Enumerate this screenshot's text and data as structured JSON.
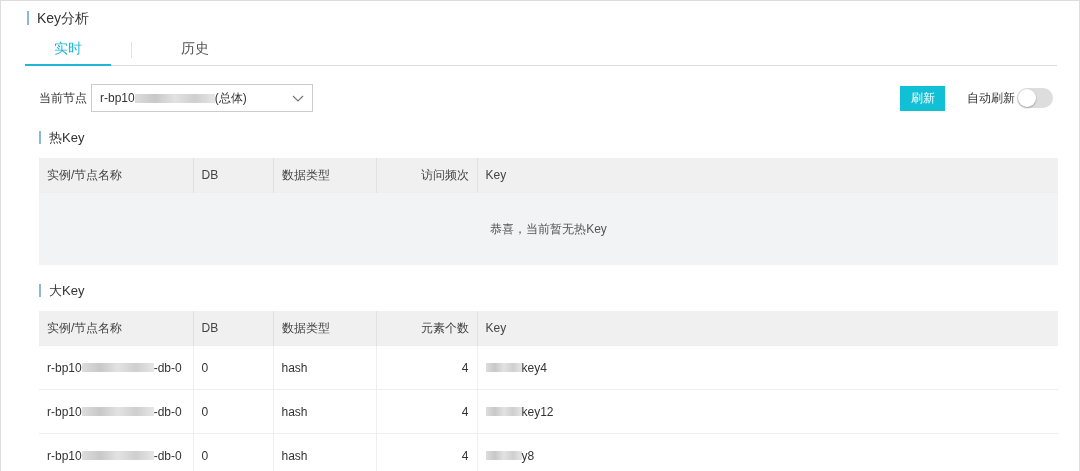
{
  "title": "Key分析",
  "tabs": [
    {
      "label": "实时",
      "selected": true
    },
    {
      "label": "历史",
      "selected": false
    }
  ],
  "node": {
    "label": "当前节点",
    "prefix": "r-bp10",
    "suffix": "(总体)"
  },
  "refresh_button": "刷新",
  "auto_refresh": {
    "label": "自动刷新",
    "on": false
  },
  "hot_key": {
    "title": "热Key",
    "columns": [
      "实例/节点名称",
      "DB",
      "数据类型",
      "访问频次",
      "Key"
    ],
    "empty": "恭喜，当前暂无热Key"
  },
  "big_key": {
    "title": "大Key",
    "columns": [
      "实例/节点名称",
      "DB",
      "数据类型",
      "元素个数",
      "Key"
    ],
    "rows": [
      {
        "name_prefix": "r-bp10",
        "name_suffix": "-db-0",
        "db": "0",
        "type": "hash",
        "count": "4",
        "key_suffix": "key4"
      },
      {
        "name_prefix": "r-bp10",
        "name_suffix": "-db-0",
        "db": "0",
        "type": "hash",
        "count": "4",
        "key_suffix": "key12"
      },
      {
        "name_prefix": "r-bp10",
        "name_suffix": "-db-0",
        "db": "0",
        "type": "hash",
        "count": "4",
        "key_suffix": "y8"
      }
    ]
  }
}
